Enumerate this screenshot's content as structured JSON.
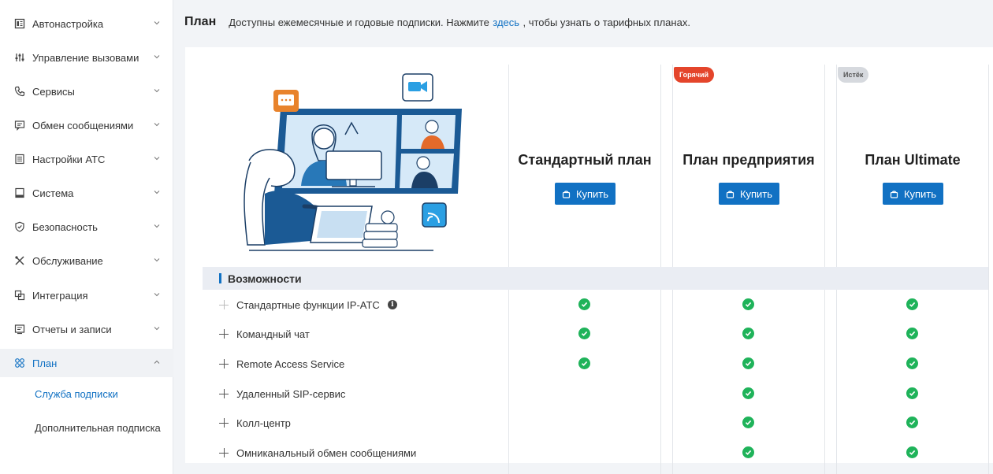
{
  "sidebar": {
    "items": [
      {
        "label": "Автонастройка",
        "icon": "auto-config-icon"
      },
      {
        "label": "Управление вызовами",
        "icon": "sliders-icon"
      },
      {
        "label": "Сервисы",
        "icon": "phone-icon"
      },
      {
        "label": "Обмен сообщениями",
        "icon": "chat-icon"
      },
      {
        "label": "Настройки АТС",
        "icon": "server-icon"
      },
      {
        "label": "Система",
        "icon": "monitor-icon"
      },
      {
        "label": "Безопасность",
        "icon": "shield-icon"
      },
      {
        "label": "Обслуживание",
        "icon": "tools-icon"
      },
      {
        "label": "Интеграция",
        "icon": "integration-icon"
      },
      {
        "label": "Отчеты и записи",
        "icon": "report-icon"
      },
      {
        "label": "План",
        "icon": "plan-icon"
      }
    ],
    "subitems": [
      {
        "label": "Служба подписки"
      },
      {
        "label": "Дополнительная подписка"
      }
    ]
  },
  "header": {
    "title": "План",
    "note_before": "Доступны ежемесячные и годовые подписки. Нажмите",
    "link": "здесь",
    "note_after": ", чтобы узнать о тарифных планах."
  },
  "plans": [
    {
      "name": "Стандартный план",
      "buy_label": "Купить",
      "tag": ""
    },
    {
      "name": "План предприятия",
      "buy_label": "Купить",
      "tag": "Горячий"
    },
    {
      "name": "План Ultimate",
      "buy_label": "Купить",
      "tag": "Истёк"
    }
  ],
  "features": {
    "title": "Возможности",
    "rows": [
      {
        "label": "Стандартные функции IP-АТС",
        "info": true,
        "plans": [
          true,
          true,
          true
        ]
      },
      {
        "label": "Командный чат",
        "plans": [
          true,
          true,
          true
        ]
      },
      {
        "label": "Remote Access Service",
        "plans": [
          true,
          true,
          true
        ]
      },
      {
        "label": "Удаленный SIP-сервис",
        "plans": [
          false,
          true,
          true
        ]
      },
      {
        "label": "Колл-центр",
        "plans": [
          false,
          true,
          true
        ]
      },
      {
        "label": "Омниканальный обмен сообщениями",
        "plans": [
          false,
          true,
          true
        ]
      }
    ]
  },
  "colors": {
    "accent": "#1171c3",
    "hot": "#e4452b",
    "check": "#1fb35a"
  }
}
